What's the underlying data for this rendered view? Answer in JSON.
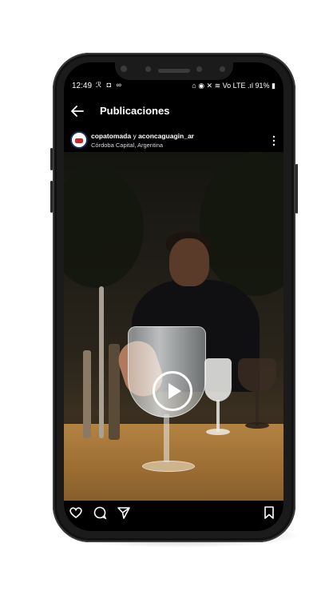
{
  "status_bar": {
    "time": "12:49",
    "left_icons": "ℛ ◘ ∞",
    "right_icons": "⌂ ◉ ✕ ≋ Vo LTE .ıl",
    "battery": "91%"
  },
  "top_bar": {
    "back_icon": "back-arrow",
    "title": "Publicaciones"
  },
  "post": {
    "user1": "copatomada",
    "joiner": " y ",
    "user2": "aconcaguagin_ar",
    "location": "Córdoba Capital, Argentina",
    "more_icon": "more-vertical",
    "media_type": "video",
    "muted": true
  },
  "actions": {
    "icons": [
      "heart-icon",
      "comment-icon",
      "share-icon",
      "bookmark-icon"
    ]
  },
  "colors": {
    "screen_bg": "#000000",
    "phone_body": "#1b1b1b",
    "text": "#ffffff"
  }
}
